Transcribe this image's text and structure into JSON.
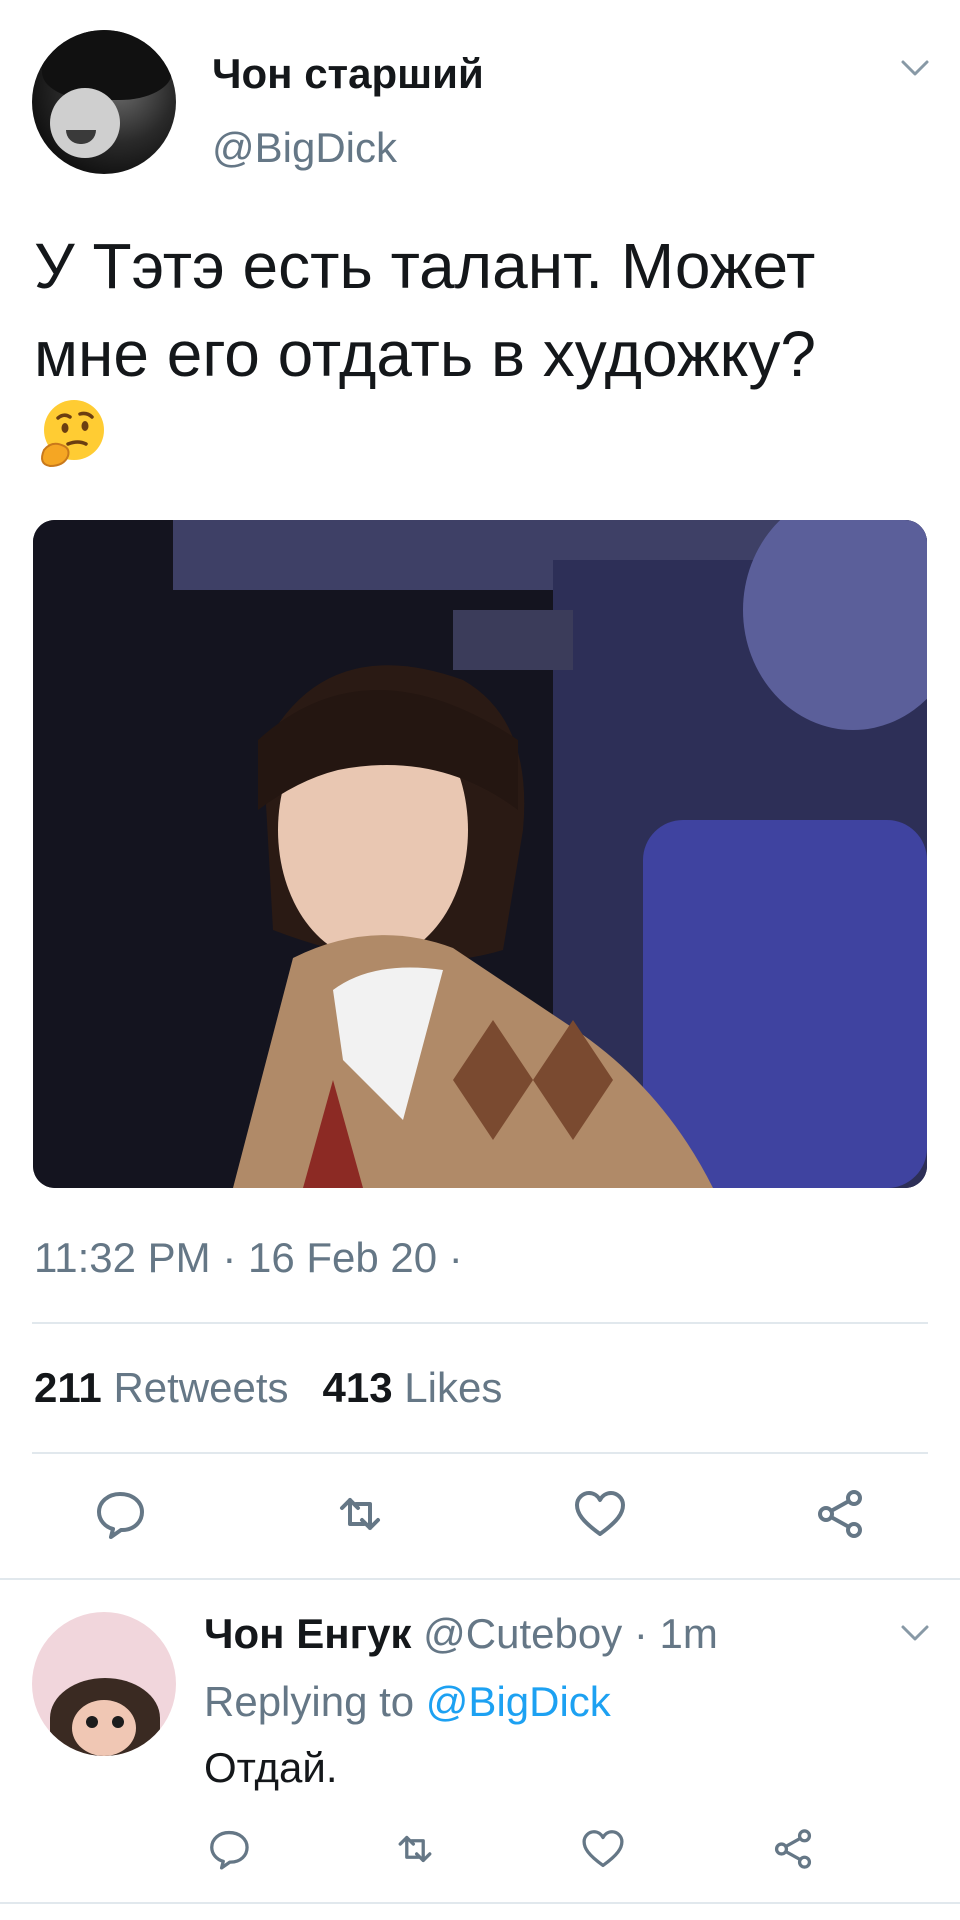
{
  "tweet": {
    "author_name": "Чон старший",
    "author_handle": "@BigDick",
    "text_lines": [
      "У Тэтэ есть талант. Может",
      "мне его отдать в художку?"
    ],
    "emoji": "thinking-face-emoji",
    "timestamp": "11:32 PM · 16 Feb 20 ·",
    "retweets_count": "211",
    "retweets_label": "Retweets",
    "likes_count": "413",
    "likes_label": "Likes",
    "actions": [
      "reply-icon",
      "retweet-icon",
      "like-icon",
      "share-icon"
    ]
  },
  "reply": {
    "author_name": "Чон Енгук",
    "meta": "@Cuteboy · 1m",
    "replying_prefix": "Replying to",
    "replying_mention": "@BigDick",
    "text": "Отдай.",
    "actions": [
      "reply-icon",
      "retweet-icon",
      "like-icon",
      "share-icon"
    ]
  },
  "colors": {
    "text_primary": "#14171a",
    "text_secondary": "#657786",
    "link": "#1da1f2",
    "divider": "#e1e8ed",
    "icon": "#657786"
  }
}
